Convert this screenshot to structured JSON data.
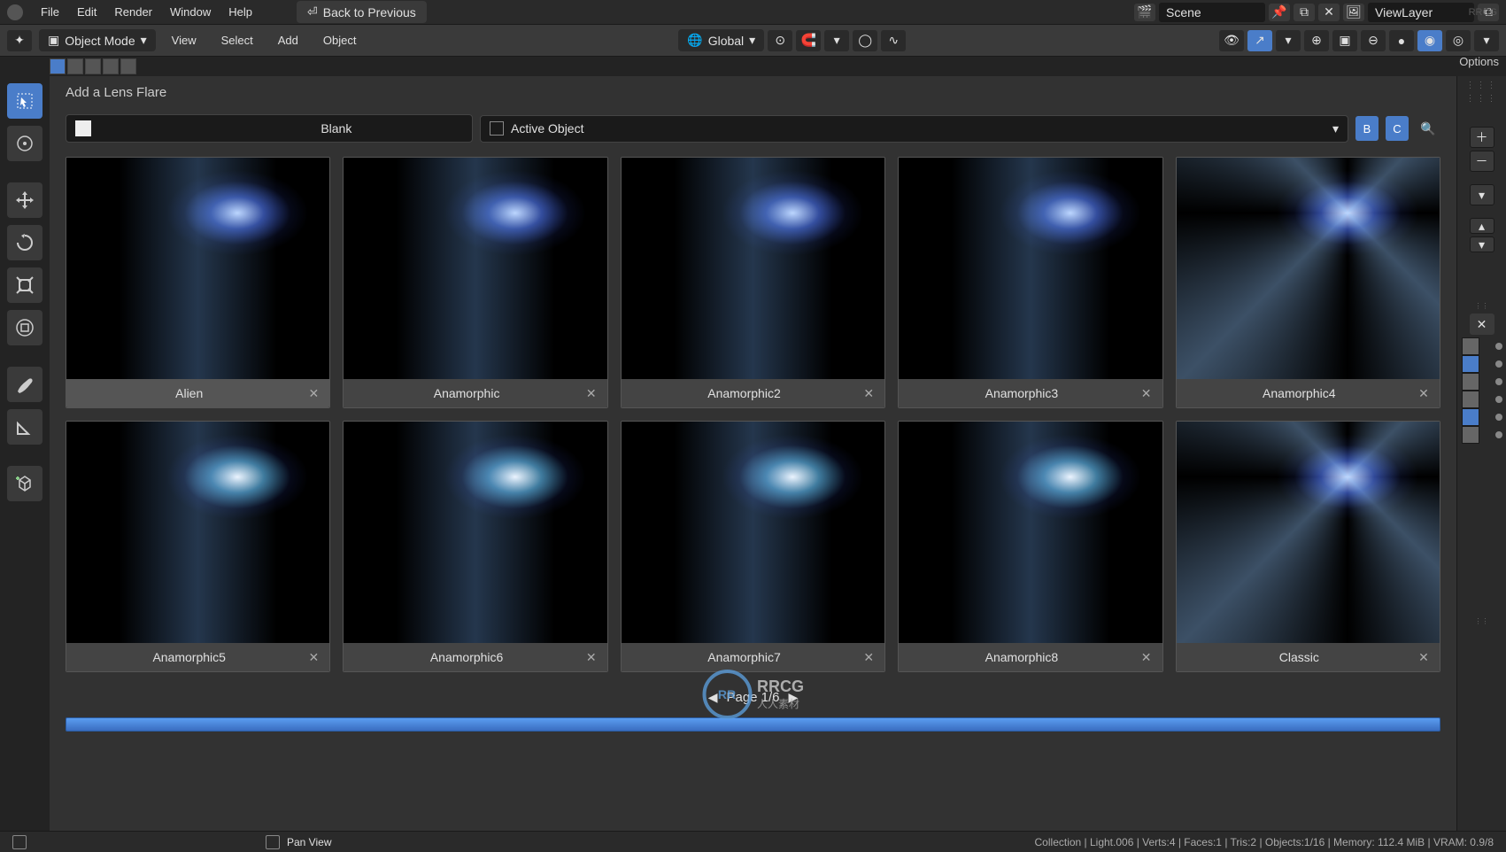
{
  "topmenu": {
    "items": [
      "File",
      "Edit",
      "Render",
      "Window",
      "Help"
    ],
    "back_label": "Back to Previous",
    "scene_label": "Scene",
    "layer_label": "ViewLayer"
  },
  "toolbar2": {
    "mode_label": "Object Mode",
    "menus": [
      "View",
      "Select",
      "Add",
      "Object"
    ],
    "orientation": "Global"
  },
  "panel": {
    "title": "Add a Lens Flare",
    "blank_label": "Blank",
    "active_obj_label": "Active Object",
    "filter_letters": [
      "B",
      "C"
    ]
  },
  "flares": [
    {
      "name": "Alien",
      "highlighted": true
    },
    {
      "name": "Anamorphic",
      "highlighted": false
    },
    {
      "name": "Anamorphic2",
      "highlighted": false
    },
    {
      "name": "Anamorphic3",
      "highlighted": false
    },
    {
      "name": "Anamorphic4",
      "highlighted": false
    },
    {
      "name": "Anamorphic5",
      "highlighted": false
    },
    {
      "name": "Anamorphic6",
      "highlighted": false
    },
    {
      "name": "Anamorphic7",
      "highlighted": false
    },
    {
      "name": "Anamorphic8",
      "highlighted": false
    },
    {
      "name": "Classic",
      "highlighted": false
    }
  ],
  "pagination": {
    "label": "Page 1/6"
  },
  "sidebar_colors": [
    "#666666",
    "#4a7dc9",
    "#666666",
    "#666666",
    "#4a7dc9",
    "#666666"
  ],
  "statusbar": {
    "pan": "Pan View",
    "info": "Collection | Light.006 | Verts:4 | Faces:1 | Tris:2 | Objects:1/16 | Memory: 112.4 MiB | VRAM: 0.9/8"
  },
  "options_label": "Options",
  "watermark_top": "RRCG",
  "center_logo": {
    "abbr": "RR",
    "text": "RRCG",
    "sub": "人人素材"
  }
}
